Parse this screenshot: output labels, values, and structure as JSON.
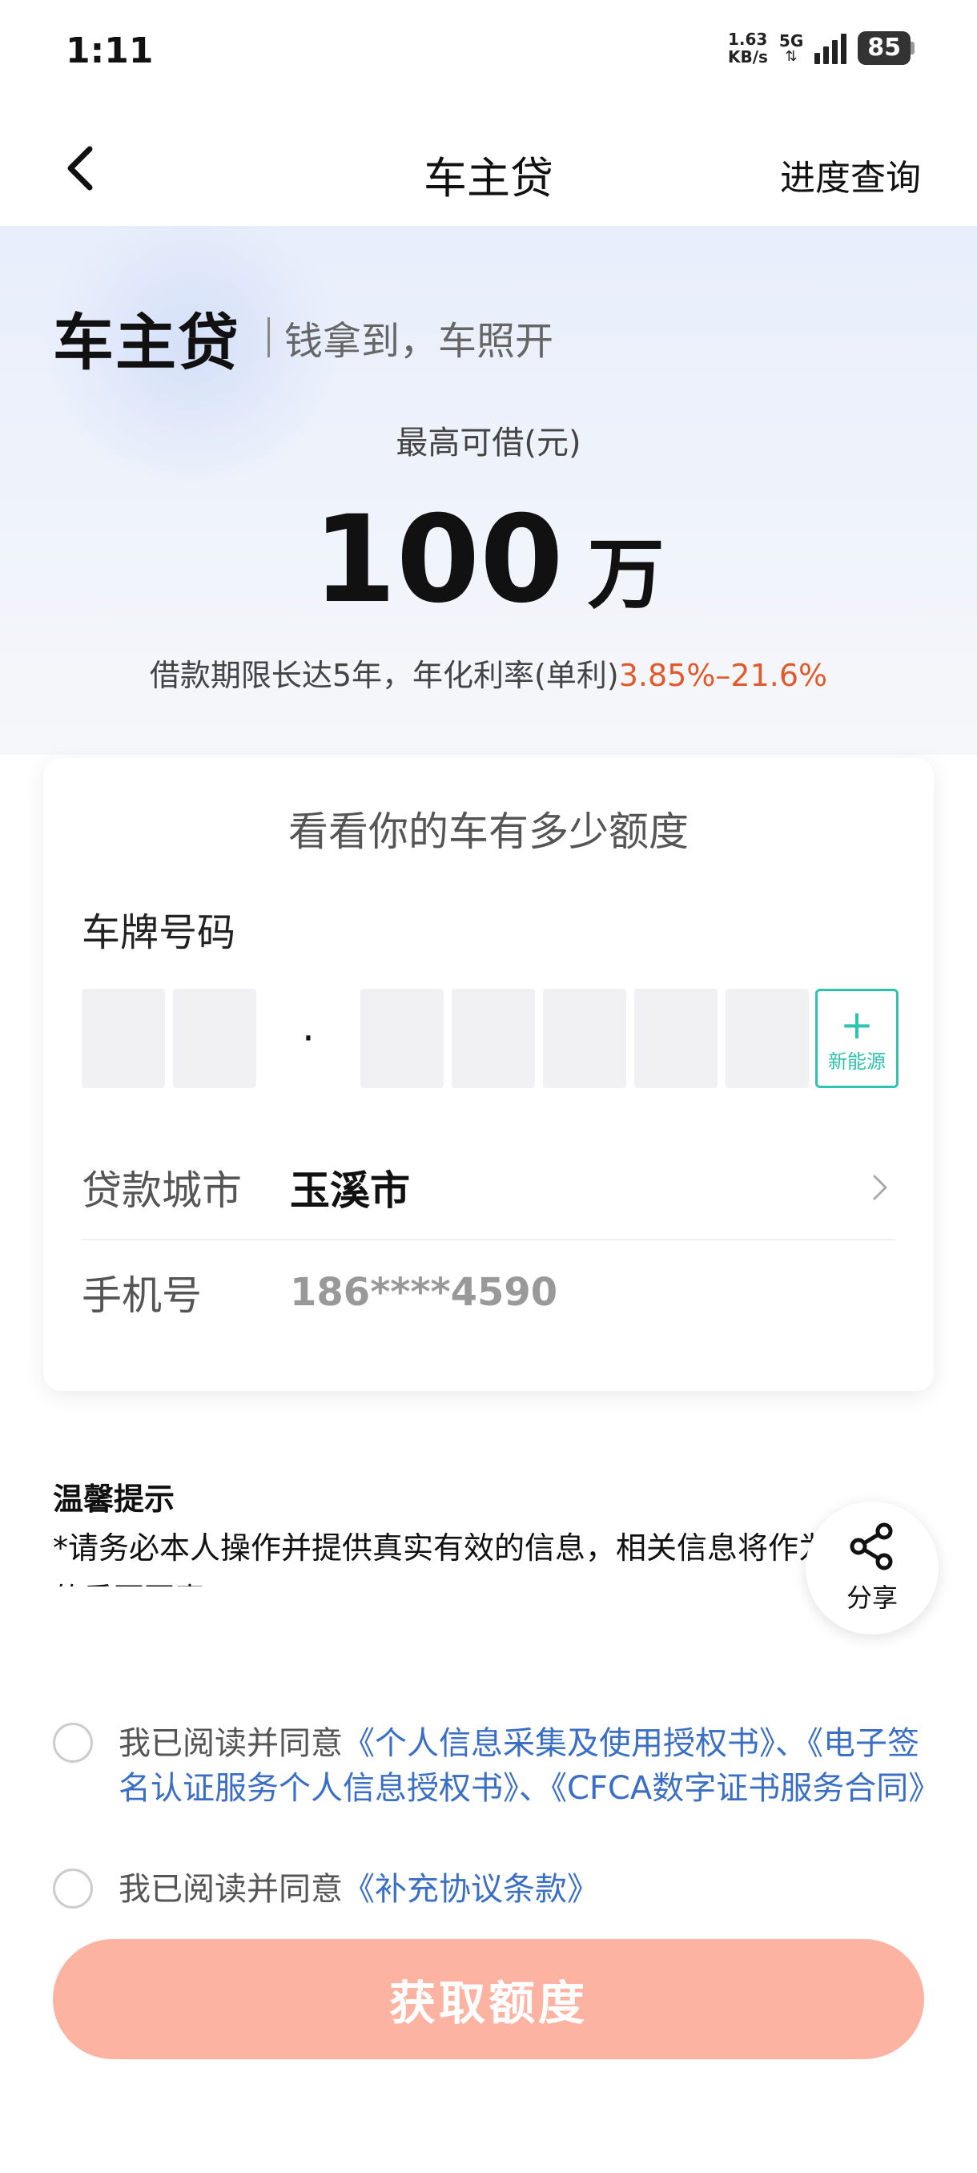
{
  "status_bar": {
    "time": "1:11",
    "net_speed_value": "1.63",
    "net_speed_unit": "KB/s",
    "network": "5G",
    "battery": "85"
  },
  "nav": {
    "back_icon": "chevron-left-icon",
    "title": "车主贷",
    "right_link": "进度查询"
  },
  "hero": {
    "brand": "车主贷",
    "slogan": "钱拿到，车照开",
    "amount_label": "最高可借(元)",
    "amount": "100",
    "amount_unit": "万",
    "desc": "借款期限长达5年，年化利率(单利)",
    "rate": "3.85%–21.6%",
    "rate_color": "#e05a2b"
  },
  "card": {
    "title": "看看你的车有多少额度",
    "plate_label": "车牌号码",
    "plate_separator": "·",
    "new_energy_plus": "+",
    "new_energy_label": "新能源",
    "city_label": "贷款城市",
    "city_value": "玉溪市",
    "phone_label": "手机号",
    "phone_value": "186****4590"
  },
  "tips": {
    "title": "温馨提示",
    "text": "*请务必本人操作并提供真实有效的信息，相关信息将作为借贷款的重要要素；"
  },
  "share": {
    "icon": "share-icon",
    "label": "分享"
  },
  "agreements": {
    "prefix": "我已阅读并同意",
    "links_1": "《个人信息采集及使用授权书》、《电子签名认证服务个人信息授权书》、《CFCA数字证书服务合同》",
    "links_2": "《补充协议条款》"
  },
  "submit": {
    "label": "获取额度",
    "color": "#fdb3a2"
  }
}
